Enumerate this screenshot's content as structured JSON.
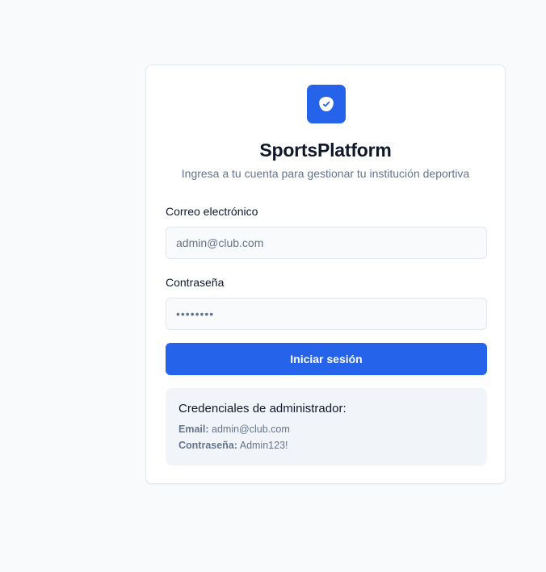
{
  "app": {
    "name": "SportsPlatform",
    "subtitle": "Ingresa a tu cuenta para gestionar tu institución deportiva",
    "logo_icon": "medal-icon",
    "accent_color": "#2563eb"
  },
  "form": {
    "email_label": "Correo electrónico",
    "email_value": "admin@club.com",
    "password_label": "Contraseña",
    "password_value": "••••••••",
    "submit_label": "Iniciar sesión"
  },
  "credentials": {
    "title": "Credenciales de administrador:",
    "email_key": "Email:",
    "email_value": "admin@club.com",
    "password_key": "Contraseña:",
    "password_value": "Admin123!"
  }
}
